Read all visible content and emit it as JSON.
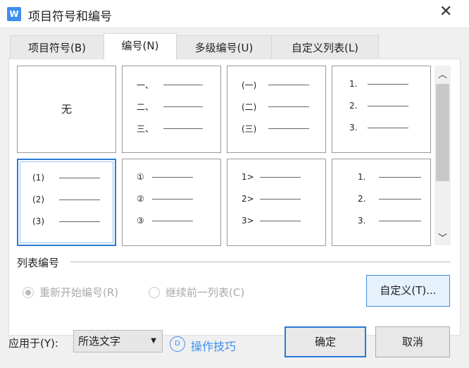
{
  "window": {
    "title": "项目符号和编号",
    "logo": "W"
  },
  "tabs": [
    {
      "label": "项目符号(B)"
    },
    {
      "label": "编号(N)"
    },
    {
      "label": "多级编号(U)"
    },
    {
      "label": "自定义列表(L)"
    }
  ],
  "styles": [
    {
      "none": "无"
    },
    {
      "labels": [
        "一、",
        "二、",
        "三、"
      ]
    },
    {
      "labels": [
        "(一)",
        "(二)",
        "(三)"
      ]
    },
    {
      "labels": [
        "1.",
        "2.",
        "3."
      ]
    },
    {
      "labels": [
        "(1)",
        "(2)",
        "(3)"
      ],
      "selected": true
    },
    {
      "labels": [
        "①",
        "②",
        "③"
      ]
    },
    {
      "labels": [
        "1>",
        "2>",
        "3>"
      ]
    },
    {
      "labels": [
        "1.",
        "2.",
        "3."
      ]
    }
  ],
  "list_numbering": {
    "label": "列表编号",
    "restart": "重新开始编号(R)",
    "continue": "继续前一列表(C)",
    "customize": "自定义(T)..."
  },
  "footer": {
    "apply_label": "应用于(Y):",
    "apply_value": "所选文字",
    "tips": "操作技巧",
    "ok": "确定",
    "cancel": "取消"
  },
  "colors": {
    "accent": "#2a7ad6",
    "link": "#3d8ef0"
  }
}
